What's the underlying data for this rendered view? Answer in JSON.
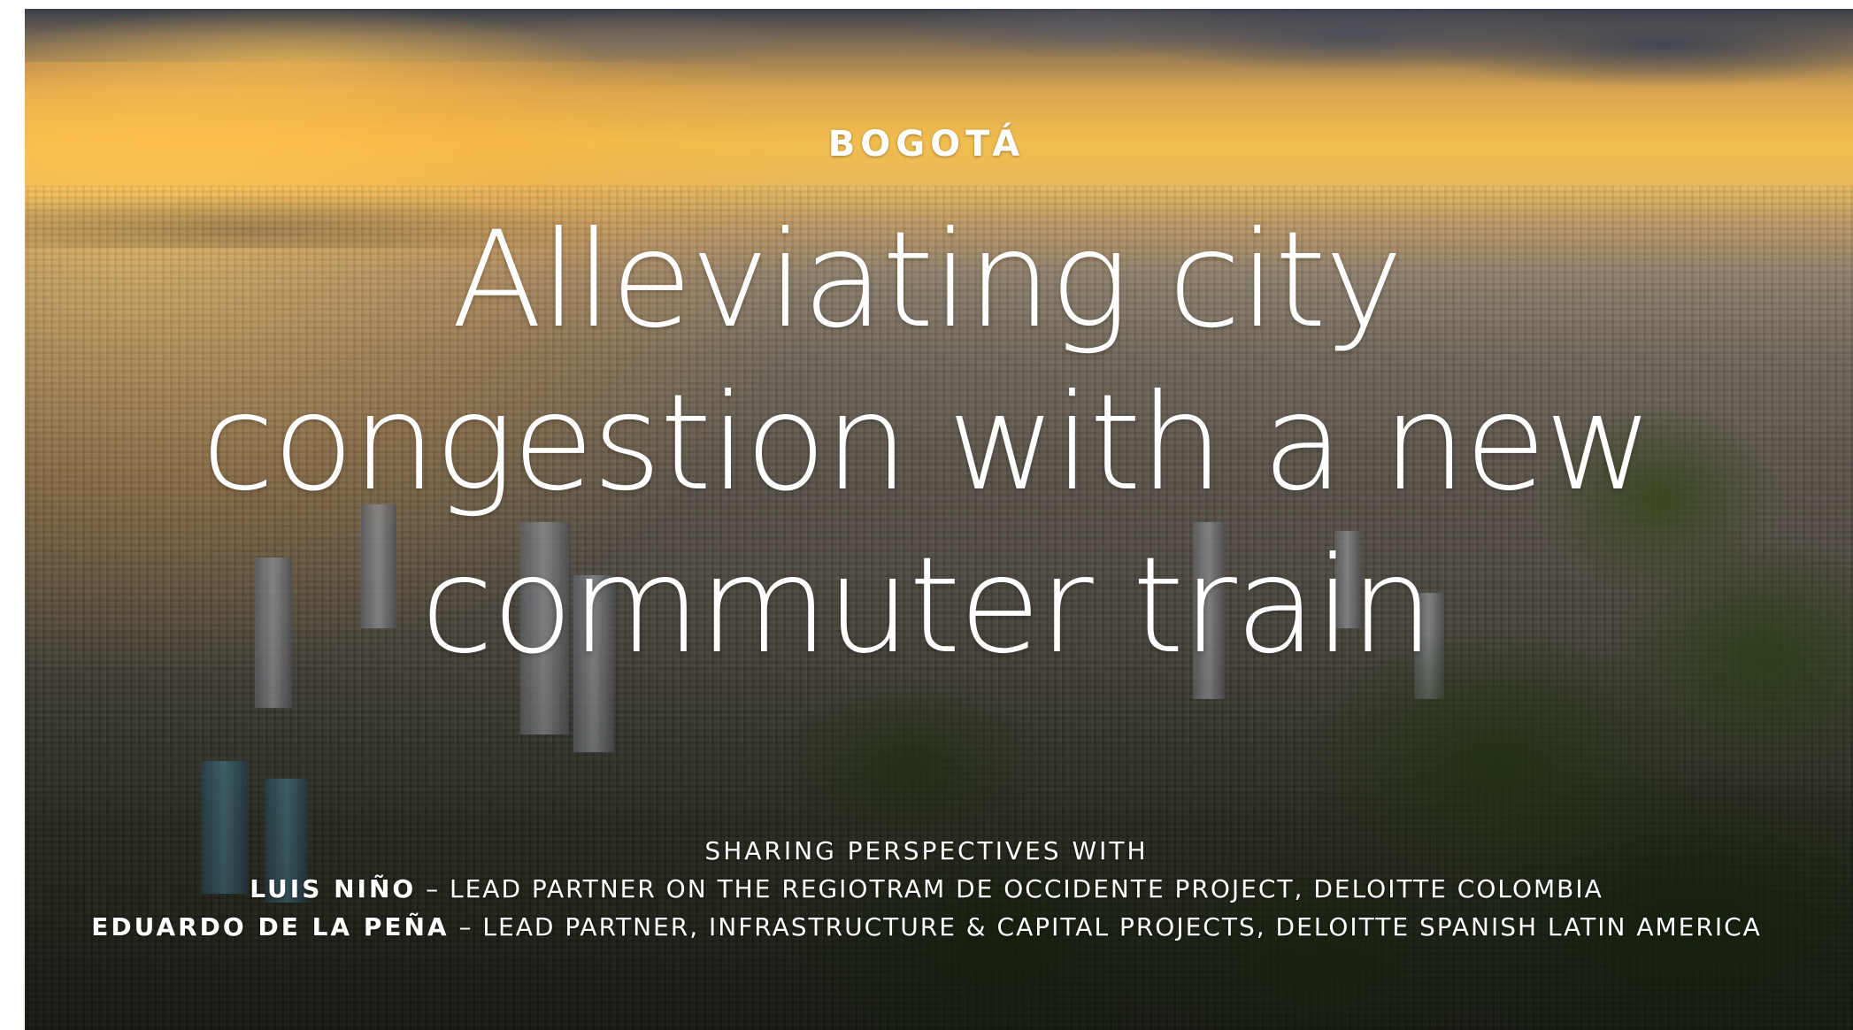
{
  "page": {
    "kicker": "BOGOTÁ",
    "headline": "Alleviating city congestion with a new commuter train"
  },
  "credits": {
    "intro": "SHARING PERSPECTIVES WITH",
    "people": [
      {
        "name": "LUIS NIÑO",
        "separator": " – ",
        "role": "LEAD PARTNER ON THE REGIOTRAM DE OCCIDENTE PROJECT, DELOITTE COLOMBIA"
      },
      {
        "name": "EDUARDO DE LA PEÑA",
        "separator": " – ",
        "role": "LEAD PARTNER, INFRASTRUCTURE & CAPITAL PROJECTS, DELOITTE SPANISH LATIN AMERICA"
      }
    ]
  },
  "colors": {
    "text": "#ffffff",
    "page_background": "#ffffff",
    "sky_gold": "#f1bd4e",
    "forest_green": "#2c2e22"
  }
}
